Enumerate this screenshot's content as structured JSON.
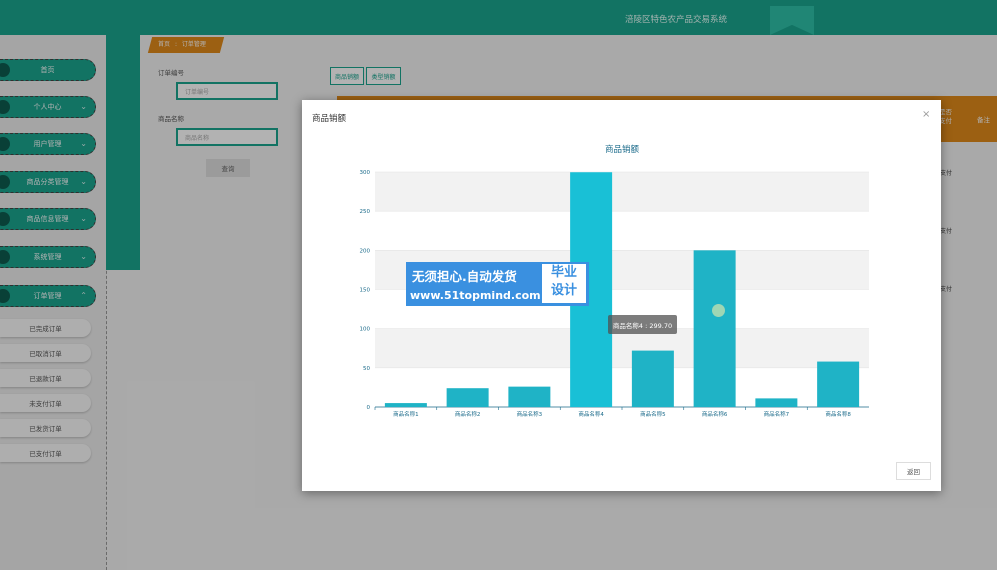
{
  "header": {
    "system_title": "涪陵区特色农产品交易系统"
  },
  "sidebar": {
    "menu": [
      {
        "label": "首页",
        "has_chevron": false
      },
      {
        "label": "个人中心",
        "has_chevron": true
      },
      {
        "label": "用户管理",
        "has_chevron": true
      },
      {
        "label": "商品分类管理",
        "has_chevron": true
      },
      {
        "label": "商品信息管理",
        "has_chevron": true
      },
      {
        "label": "系统管理",
        "has_chevron": true
      },
      {
        "label": "订单管理",
        "has_chevron": true,
        "expanded": true
      }
    ],
    "submenu": [
      "已完成订单",
      "已取消订单",
      "已退款订单",
      "未支付订单",
      "已发货订单",
      "已支付订单"
    ]
  },
  "breadcrumb": {
    "home": "首页",
    "sep": ":",
    "current": "订单管理"
  },
  "search": {
    "order_no_label": "订单编号",
    "order_no_placeholder": "订单编号",
    "product_name_label": "商品名称",
    "product_name_placeholder": "商品名称",
    "query_button": "查询"
  },
  "toolbar": {
    "btn1": "商品销额",
    "btn2": "类型销额"
  },
  "table": {
    "header_right1": "是否\n支付",
    "header_right2": "备注",
    "cells": [
      "支付",
      "支付",
      "支付"
    ]
  },
  "modal": {
    "title": "商品销额",
    "close": "×",
    "back_button": "返回",
    "tooltip": "商品名称4 : 299.70"
  },
  "watermark": {
    "line1": "无须担心.自动发货",
    "line2": "www.51topmind.com",
    "box": "毕业\n设计"
  },
  "colors": {
    "teal": "#1aa58f",
    "orange": "#e08a1a",
    "bar": "#1fb6c8"
  },
  "chart_data": {
    "type": "bar",
    "title": "商品销额",
    "categories": [
      "商品名称1",
      "商品名称2",
      "商品名称3",
      "商品名称4",
      "商品名称5",
      "商品名称6",
      "商品名称7",
      "商品名称8"
    ],
    "values": [
      5,
      24,
      26,
      299.7,
      72,
      200,
      11,
      58
    ],
    "ylim": [
      0,
      300
    ],
    "yticks": [
      0,
      50,
      100,
      150,
      200,
      250,
      300
    ],
    "grid": true,
    "highlighted_index": 3
  }
}
